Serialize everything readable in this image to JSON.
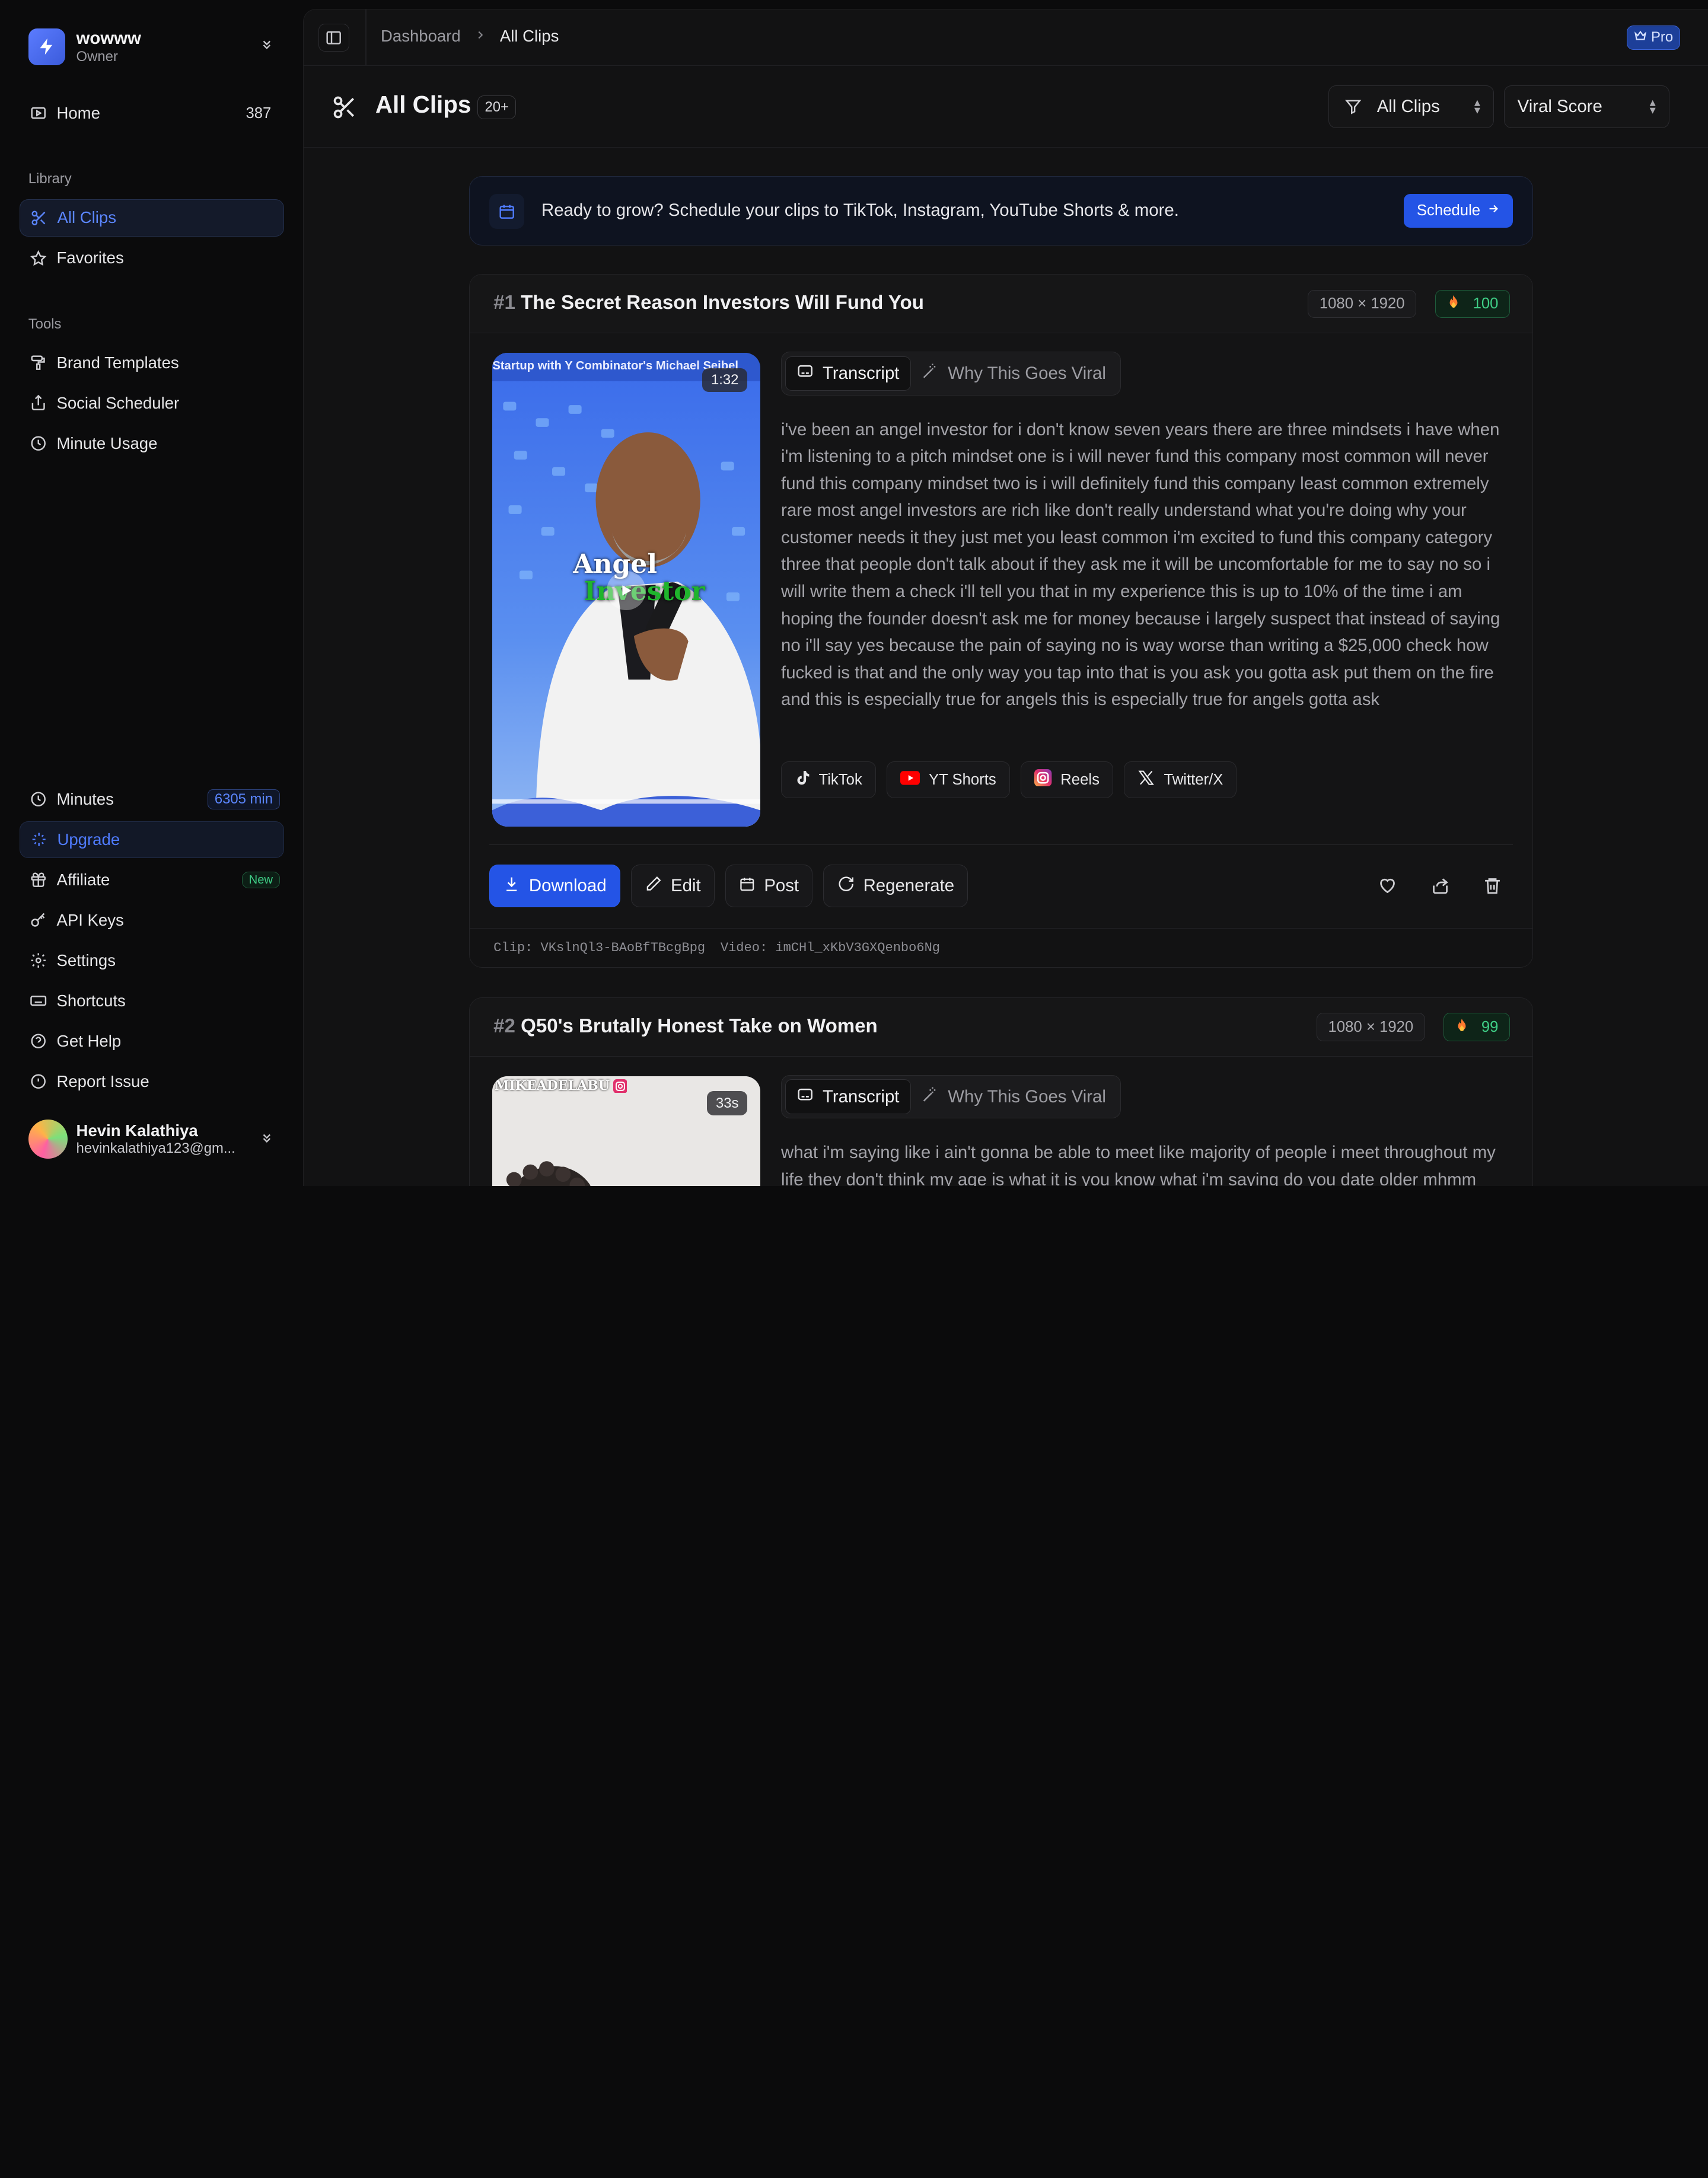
{
  "workspace": {
    "name": "wowww",
    "role": "Owner"
  },
  "nav": {
    "home": {
      "label": "Home",
      "count": "387"
    },
    "library_label": "Library",
    "all_clips": "All Clips",
    "favorites": "Favorites",
    "tools_label": "Tools",
    "brand_templates": "Brand Templates",
    "social_scheduler": "Social Scheduler",
    "minute_usage": "Minute Usage",
    "minutes": {
      "label": "Minutes",
      "value": "6305 min"
    },
    "upgrade": "Upgrade",
    "affiliate": {
      "label": "Affiliate",
      "badge": "New"
    },
    "api_keys": "API Keys",
    "settings": "Settings",
    "shortcuts": "Shortcuts",
    "get_help": "Get Help",
    "report_issue": "Report Issue"
  },
  "user": {
    "name": "Hevin Kalathiya",
    "email": "hevinkalathiya123@gm..."
  },
  "breadcrumb": {
    "root": "Dashboard",
    "current": "All Clips"
  },
  "plan_badge": "Pro",
  "page": {
    "title": "All Clips",
    "count_badge": "20+",
    "filter_select": "All Clips",
    "sort_select": "Viral Score"
  },
  "banner": {
    "text": "Ready to grow? Schedule your clips to TikTok, Instagram, YouTube Shorts & more.",
    "button": "Schedule"
  },
  "clips": [
    {
      "rank": "#1",
      "title": "The Secret Reason Investors Will Fund You",
      "resolution": "1080 × 1920",
      "score": "100",
      "duration": "1:32",
      "thumb_caption": "Startup with Y Combinator's Michael Seibel",
      "thumb_overlay_1": "Angel",
      "thumb_overlay_2": "Investor",
      "tab_transcript": "Transcript",
      "tab_viral": "Why This Goes Viral",
      "transcript": "i've been an angel investor for i don't know seven years there are three mindsets i have when i'm listening to a pitch mindset one is i will never fund this company most common will never fund this company mindset two is i will definitely fund this company least common extremely rare most angel investors are rich like don't really understand what you're doing why your customer needs it they just met you least common i'm excited to fund this company category three that people don't talk about if they ask me it will be uncomfortable for me to say no so i will write them a check i'll tell you that in my experience this is up to 10% of the time i am hoping the founder doesn't ask me for money because i largely suspect that instead of saying no i'll say yes because the pain of saying no is way worse than writing a $25,000 check how fucked is that and the only way you tap into that is you ask you gotta ask put them on the fire and this is especially true for angels this is especially true for angels gotta ask",
      "platforms": [
        "TikTok",
        "YT Shorts",
        "Reels",
        "Twitter/X"
      ],
      "actions": {
        "download": "Download",
        "edit": "Edit",
        "post": "Post",
        "regenerate": "Regenerate"
      },
      "clip_id": "Clip: VKslnQl3-BAoBfTBcgBpg",
      "video_id": "Video: imCHl_xKbV3GXQenbo6Ng"
    },
    {
      "rank": "#2",
      "title": "Q50's Brutally Honest Take on Women",
      "resolution": "1080 × 1920",
      "score": "99",
      "duration": "33s",
      "thumb_caption": "MIKEADELABU",
      "tab_transcript": "Transcript",
      "tab_viral": "Why This Goes Viral",
      "transcript": "what i'm saying like i ain't gonna be able to meet like majority of people i meet throughout my life they don't think my age is what it is you know what i'm saying do you date older mhmm you"
    }
  ],
  "colors": {
    "accent": "#2454e6",
    "score_green": "#3fce86",
    "bg": "#0b0b0c"
  }
}
